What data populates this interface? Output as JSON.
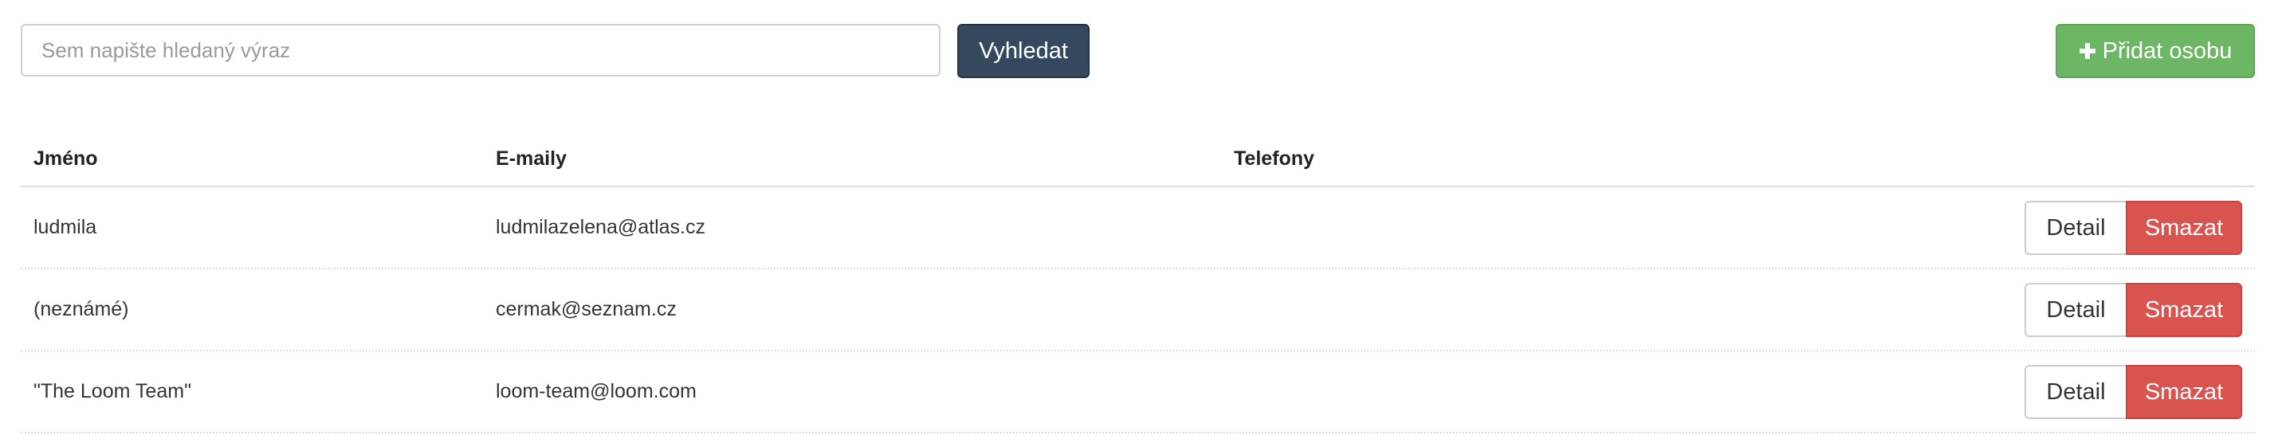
{
  "search": {
    "placeholder": "Sem napište hledaný výraz",
    "value": "",
    "button_label": "Vyhledat"
  },
  "add_person": {
    "icon": "plus-icon",
    "label": "Přidat osobu",
    "color": "#6cb664"
  },
  "table": {
    "headers": {
      "name": "Jméno",
      "emails": "E-maily",
      "phones": "Telefony"
    },
    "rows": [
      {
        "name": "ludmila",
        "email": "ludmilazelena@atlas.cz",
        "phone": "",
        "detail_label": "Detail",
        "delete_label": "Smazat"
      },
      {
        "name": "(neznámé)",
        "email": "cermak@seznam.cz",
        "phone": "",
        "detail_label": "Detail",
        "delete_label": "Smazat"
      },
      {
        "name": "\"The Loom Team\"",
        "email": "loom-team@loom.com",
        "phone": "",
        "detail_label": "Detail",
        "delete_label": "Smazat"
      }
    ]
  },
  "colors": {
    "search_button": "#34495e",
    "delete_button": "#d9534f"
  }
}
